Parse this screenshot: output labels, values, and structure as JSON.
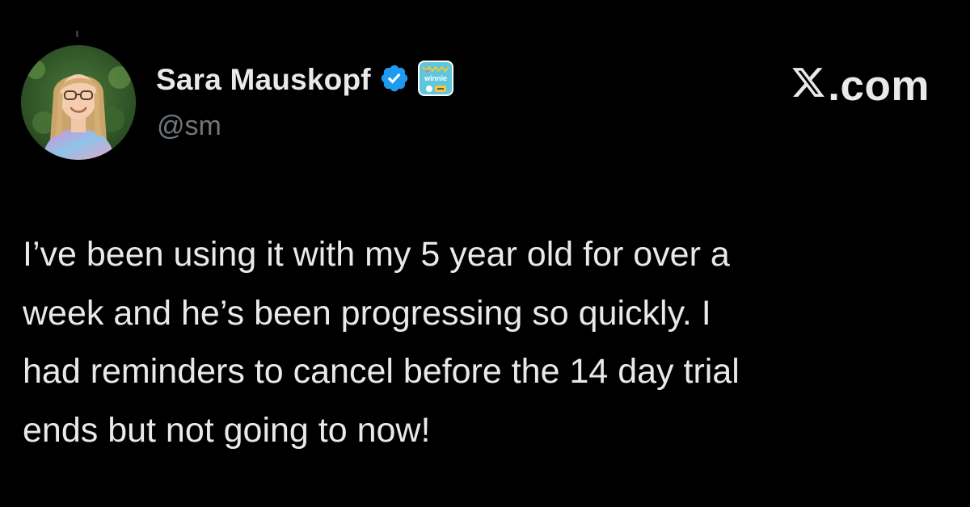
{
  "post": {
    "author": {
      "display_name": "Sara Mauskopf",
      "handle": "@sm",
      "verified": true,
      "affiliate_badge_text": "winnie"
    },
    "site_label": ".com",
    "text": "I’ve been using it with my 5 year old for over a\nweek and he’s been progressing so quickly. I\nhad reminders to cancel before the 14 day trial\nends but not going to now!"
  },
  "colors": {
    "background": "#000000",
    "text_primary": "#e7e9ea",
    "text_secondary": "#71767b",
    "verified_blue": "#1d9bf0",
    "affiliate_badge_bg": "#5ec6dd"
  },
  "icons": {
    "verified": "verified-checkmark-icon",
    "affiliate": "winnie-affiliate-badge-icon",
    "site_logo": "x-logo-icon"
  }
}
